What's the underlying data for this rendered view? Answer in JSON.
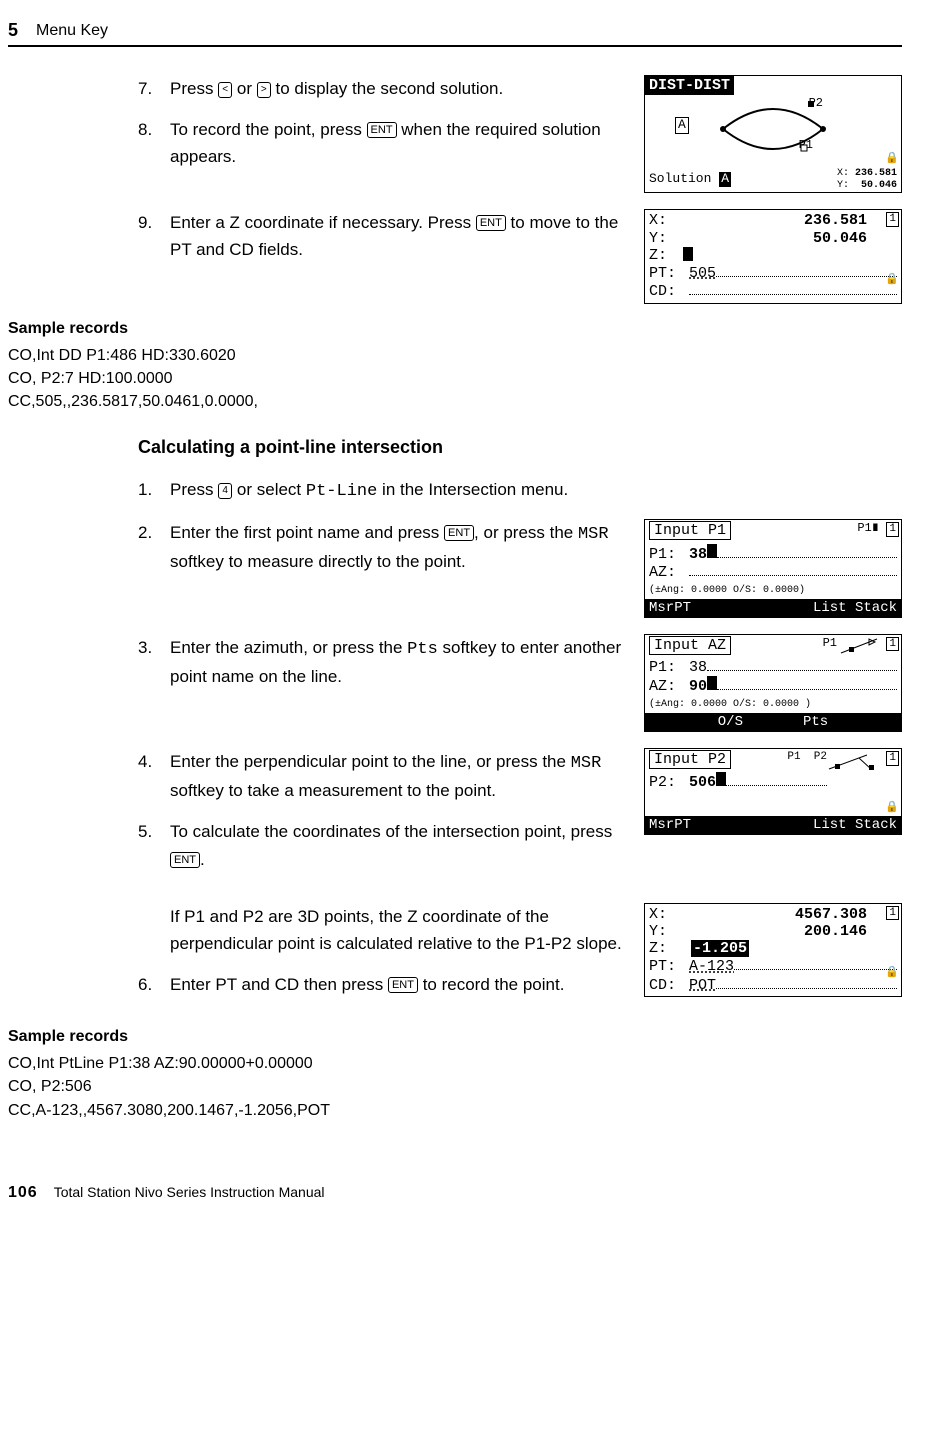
{
  "header": {
    "chapter_num": "5",
    "chapter_title": "Menu Key"
  },
  "steps_a": [
    {
      "n": "7.",
      "pre": "Press ",
      "k1": "<",
      "mid": " or ",
      "k2": ">",
      "post": " to display the second solution."
    },
    {
      "n": "8.",
      "pre": "To record the point, press ",
      "k1": "ENT",
      "post": " when the required solution appears."
    },
    {
      "n": "9.",
      "pre": "Enter a Z coordinate if necessary. Press ",
      "k1": "ENT",
      "post": " to move to the PT and CD fields."
    }
  ],
  "screen1": {
    "title": "DIST-DIST",
    "p2": "P2",
    "a": "A",
    "p1": "P1",
    "sol_lbl": "Solution",
    "sol_badge": "A",
    "xy_lbl_x": "X:",
    "xy_lbl_y": "Y:",
    "x_small": "236.581",
    "y_small": "50.046"
  },
  "screen2": {
    "x_lbl": "X:",
    "x": "236.581",
    "y_lbl": "Y:",
    "y": "50.046",
    "z_lbl": "Z:",
    "pt_lbl": "PT:",
    "pt": "505",
    "cd_lbl": "CD:"
  },
  "sample1": {
    "hdr": "Sample records",
    "l1": "CO,Int DD P1:486 HD:330.6020",
    "l2": "CO, P2:7 HD:100.0000",
    "l3": "CC,505,,236.5817,50.0461,0.0000,"
  },
  "sect_title": "Calculating a point-line intersection",
  "steps_b": [
    {
      "n": "1.",
      "pre": "Press ",
      "k1": "4",
      "mid": " or select ",
      "mono": "Pt-Line",
      "post": " in the Intersection menu."
    },
    {
      "n": "2.",
      "pre": "Enter the first point name and press ",
      "k1": "ENT",
      "mid": ", or press the ",
      "mono": "MSR",
      "post": " softkey to measure directly to the point."
    },
    {
      "n": "3.",
      "pre": "Enter the azimuth, or press the ",
      "mono": "Pts",
      "post": " softkey to enter another point name on the line."
    },
    {
      "n": "4.",
      "pre": "Enter the perpendicular point to the line, or press the ",
      "mono": "MSR",
      "post": " softkey to take a measurement to the point."
    },
    {
      "n": "5.",
      "pre": "To calculate the coordinates of the intersection point, press ",
      "k1": "ENT",
      "post": "."
    },
    {
      "n": "",
      "plain": "If P1 and P2 are 3D points, the Z coordinate of the perpendicular point is calculated relative to the P1-P2 slope."
    },
    {
      "n": "6.",
      "pre": "Enter PT and CD then press ",
      "k1": "ENT",
      "post": " to record the point."
    }
  ],
  "screen3": {
    "title": "Input P1",
    "p1m": "P1",
    "p1_lbl": "P1:",
    "p1": "38",
    "az_lbl": "AZ:",
    "hint": "(±Ang:  0.0000   O/S:  0.0000)",
    "sk1": "MsrPT",
    "sk2": "List",
    "sk3": "Stack"
  },
  "screen4": {
    "title": "Input AZ",
    "p1m": "P1",
    "p1_lbl": "P1:",
    "p1": "38",
    "az_lbl": "AZ:",
    "az": "90",
    "hint": "(±Ang:  0.0000   O/S:  0.0000 )",
    "sk1": "O/S",
    "sk2": "Pts"
  },
  "screen5": {
    "title": "Input P2",
    "p1m": "P1",
    "p2m": "P2",
    "p2_lbl": "P2:",
    "p2": "506",
    "sk1": "MsrPT",
    "sk2": "List",
    "sk3": "Stack"
  },
  "screen6": {
    "x_lbl": "X:",
    "x": "4567.308",
    "y_lbl": "Y:",
    "y": "200.146",
    "z_lbl": "Z:",
    "z": "-1.205",
    "pt_lbl": "PT:",
    "pt": "A-123",
    "cd_lbl": "CD:",
    "cd": "POT"
  },
  "sample2": {
    "hdr": "Sample records",
    "l1": "CO,Int PtLine P1:38 AZ:90.00000+0.00000",
    "l2": "CO, P2:506",
    "l3": "CC,A-123,,4567.3080,200.1467,-1.2056,POT"
  },
  "footer": {
    "page": "106",
    "title": "Total Station Nivo Series Instruction Manual"
  }
}
